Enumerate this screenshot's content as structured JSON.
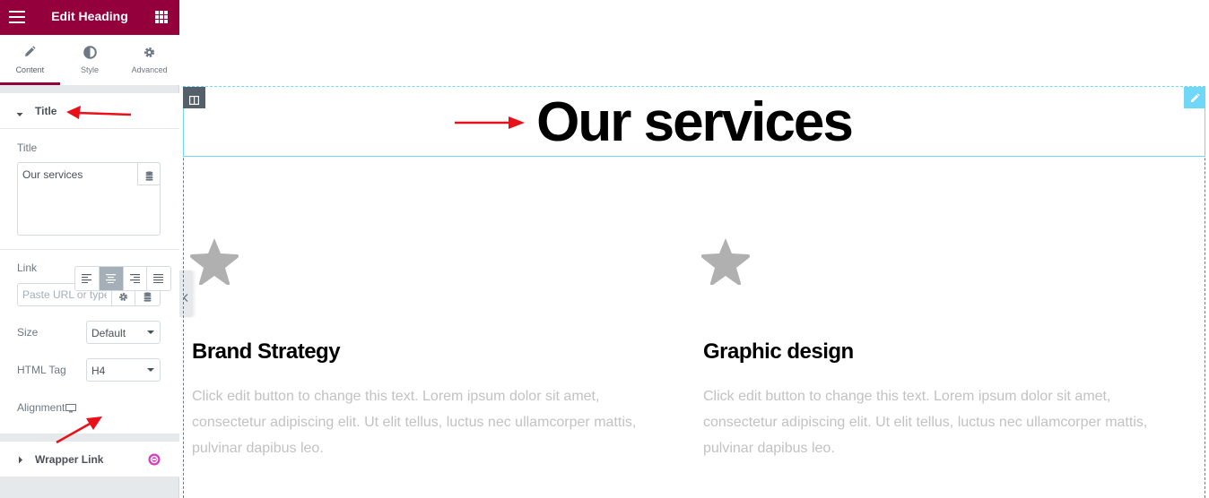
{
  "panel": {
    "title": "Edit Heading",
    "tabs": [
      {
        "label": "Content",
        "icon": "pencil-icon"
      },
      {
        "label": "Style",
        "icon": "half-circle-icon"
      },
      {
        "label": "Advanced",
        "icon": "gear-icon"
      }
    ],
    "title_section": {
      "header": "Title",
      "title_label": "Title",
      "title_value": "Our services",
      "link_label": "Link",
      "link_placeholder": "Paste URL or type",
      "size_label": "Size",
      "size_value": "Default",
      "html_tag_label": "HTML Tag",
      "html_tag_value": "H4",
      "alignment_label": "Alignment",
      "alignment_options": [
        "left",
        "center",
        "right",
        "justify"
      ],
      "alignment_selected": "center"
    },
    "wrapper_section": {
      "header": "Wrapper Link"
    }
  },
  "canvas": {
    "heading": "Our services",
    "boxes": [
      {
        "icon": "star-icon",
        "title": "Brand Strategy",
        "desc": "Click edit button to change this text. Lorem ipsum dolor sit amet, consectetur adipiscing elit. Ut elit tellus, luctus nec ullamcorper mattis, pulvinar dapibus leo."
      },
      {
        "icon": "star-icon",
        "title": "Graphic design",
        "desc": "Click edit button to change this text. Lorem ipsum dolor sit amet, consectetur adipiscing elit. Ut elit tellus, luctus nec ullamcorper mattis, pulvinar dapibus leo."
      }
    ]
  },
  "colors": {
    "brand": "#93003c",
    "annotation_arrow": "#e8101a",
    "selection": "#71d7f7"
  }
}
